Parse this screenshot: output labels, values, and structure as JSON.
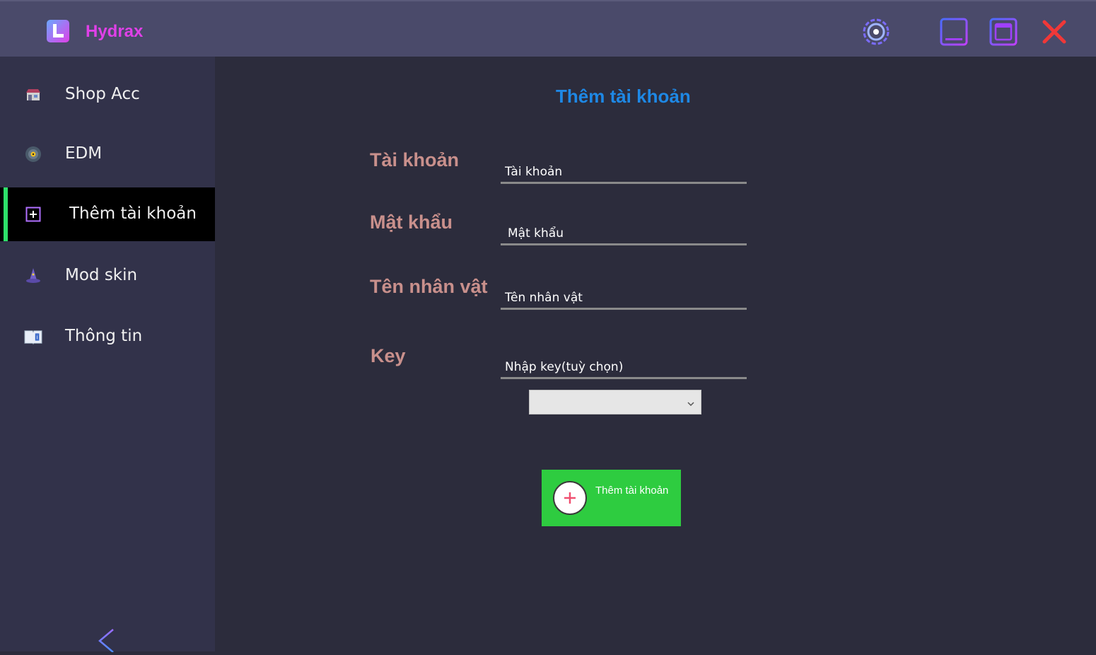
{
  "app": {
    "title": "Hydrax",
    "brand_color": "#e040e8",
    "accent_color": "#1e88e5",
    "active_indicator_color": "#2ee06a"
  },
  "titlebar": {
    "settings_icon": "settings-gear-icon",
    "minimize_icon": "minimize-icon",
    "maximize_icon": "maximize-icon",
    "close_icon": "close-icon"
  },
  "sidebar": {
    "items": [
      {
        "label": "Shop Acc",
        "icon": "shop-icon",
        "active": false
      },
      {
        "label": "EDM",
        "icon": "music-disc-icon",
        "active": false
      },
      {
        "label": "Thêm tài khoản",
        "icon": "add-box-icon",
        "active": true
      },
      {
        "label": "Mod skin",
        "icon": "wizard-hat-icon",
        "active": false
      },
      {
        "label": "Thông tin",
        "icon": "info-book-icon",
        "active": false
      }
    ],
    "collapse_icon": "chevron-left-icon"
  },
  "main": {
    "title": "Thêm tài khoản",
    "fields": [
      {
        "label": "Tài khoản",
        "placeholder": "Tài khoản",
        "value": ""
      },
      {
        "label": "Mật khẩu",
        "placeholder": "Mật khẩu",
        "value": ""
      },
      {
        "label": "Tên nhân vật",
        "placeholder": "Tên nhân vật",
        "value": ""
      },
      {
        "label": "Key",
        "placeholder": "Nhập key(tuỳ chọn)",
        "value": ""
      }
    ],
    "key_select": {
      "selected": ""
    },
    "submit_button": {
      "label": "Thêm tài khoản",
      "icon": "plus-circle-icon",
      "color": "#2ecc40"
    }
  }
}
